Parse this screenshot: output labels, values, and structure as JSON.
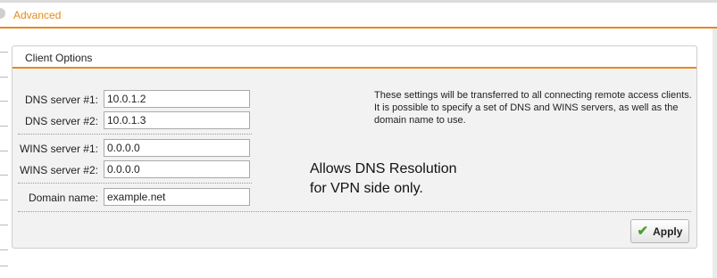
{
  "top": {
    "title": "Advanced"
  },
  "panel": {
    "title": "Client Options",
    "fields": [
      {
        "label": "DNS server #1:",
        "value": "10.0.1.2"
      },
      {
        "label": "DNS server #2:",
        "value": "10.0.1.3"
      },
      {
        "label": "WINS server #1:",
        "value": "0.0.0.0"
      },
      {
        "label": "WINS server #2:",
        "value": "0.0.0.0"
      },
      {
        "label": "Domain name:",
        "value": "example.net"
      }
    ],
    "info": "These settings will be transferred to all connecting remote access clients. It is possible to specify a set of DNS and WINS servers, as well as the domain name to use.",
    "annotation_lines": [
      "Allows DNS Resolution",
      "for VPN side only."
    ],
    "apply_label": "Apply"
  },
  "colors": {
    "accent": "#e8891a",
    "check": "#4aa02c"
  },
  "icons": {
    "apply": "checkmark-icon"
  }
}
